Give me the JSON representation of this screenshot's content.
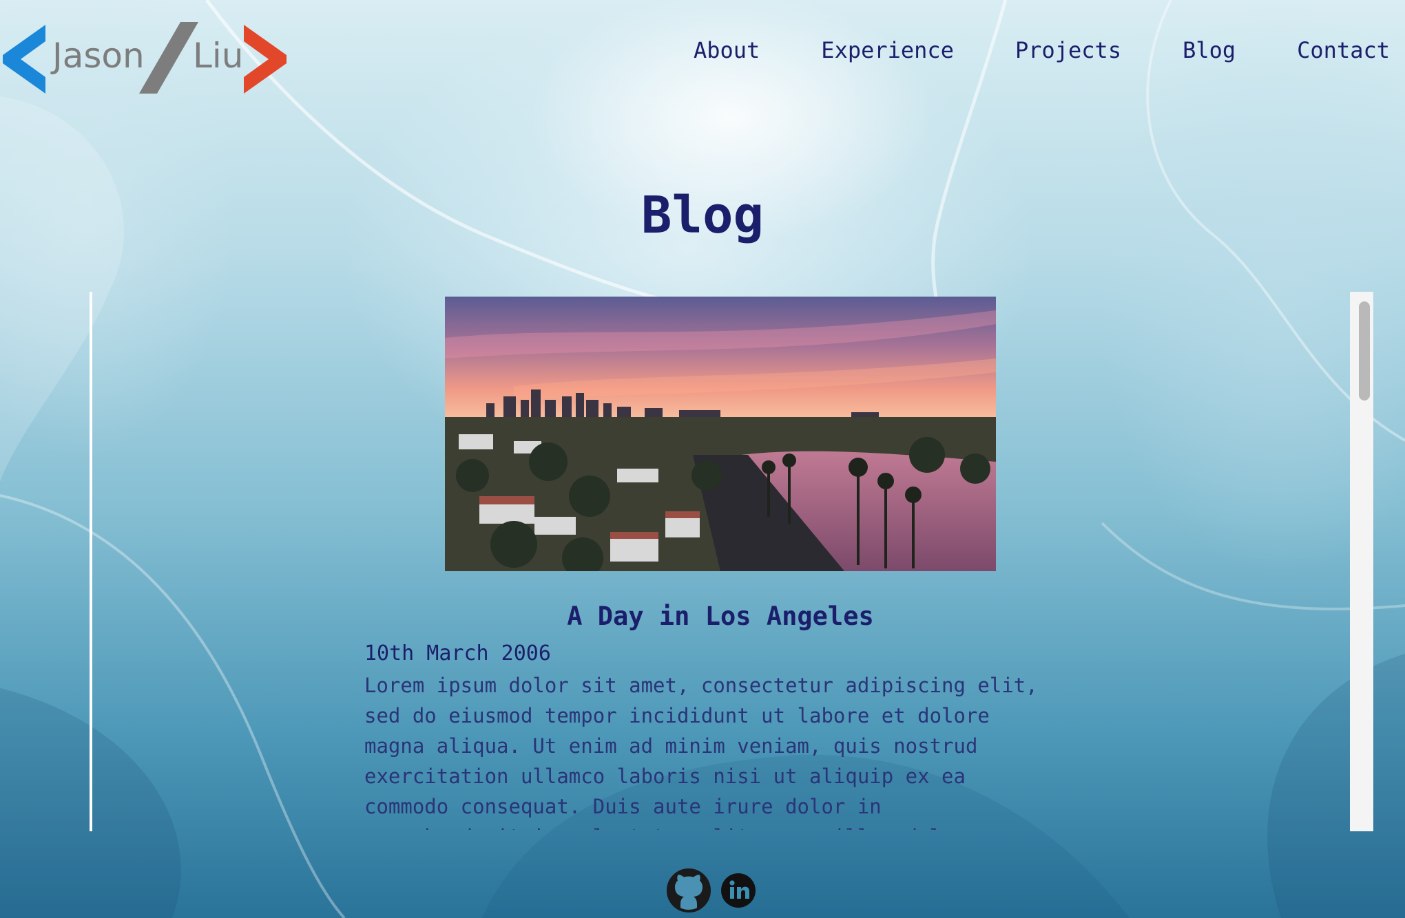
{
  "logo": {
    "first": "Jason",
    "last": "Liu",
    "colors": {
      "left": "#1b87d9",
      "slash": "#7d7d7d",
      "right": "#e3472a"
    }
  },
  "nav": [
    {
      "label": "About"
    },
    {
      "label": "Experience"
    },
    {
      "label": "Projects"
    },
    {
      "label": "Blog"
    },
    {
      "label": "Contact"
    }
  ],
  "page": {
    "title": "Blog"
  },
  "post": {
    "image": "los-angeles-sunset-aerial",
    "title": "A Day in Los Angeles",
    "date": "10th March 2006",
    "body": "Lorem ipsum dolor sit amet, consectetur adipiscing elit,\nsed do eiusmod tempor incididunt ut labore et dolore\nmagna aliqua. Ut enim ad minim veniam, quis nostrud\nexercitation ullamco laboris nisi ut aliquip ex ea\ncommodo consequat. Duis aute irure dolor in\nreprehenderit in voluptate velit esse cillum dolore"
  },
  "socials": [
    {
      "icon": "github-icon"
    },
    {
      "icon": "linkedin-icon"
    }
  ],
  "colors": {
    "text": "#1b1f6b",
    "panel_rule": "#ffffff"
  }
}
